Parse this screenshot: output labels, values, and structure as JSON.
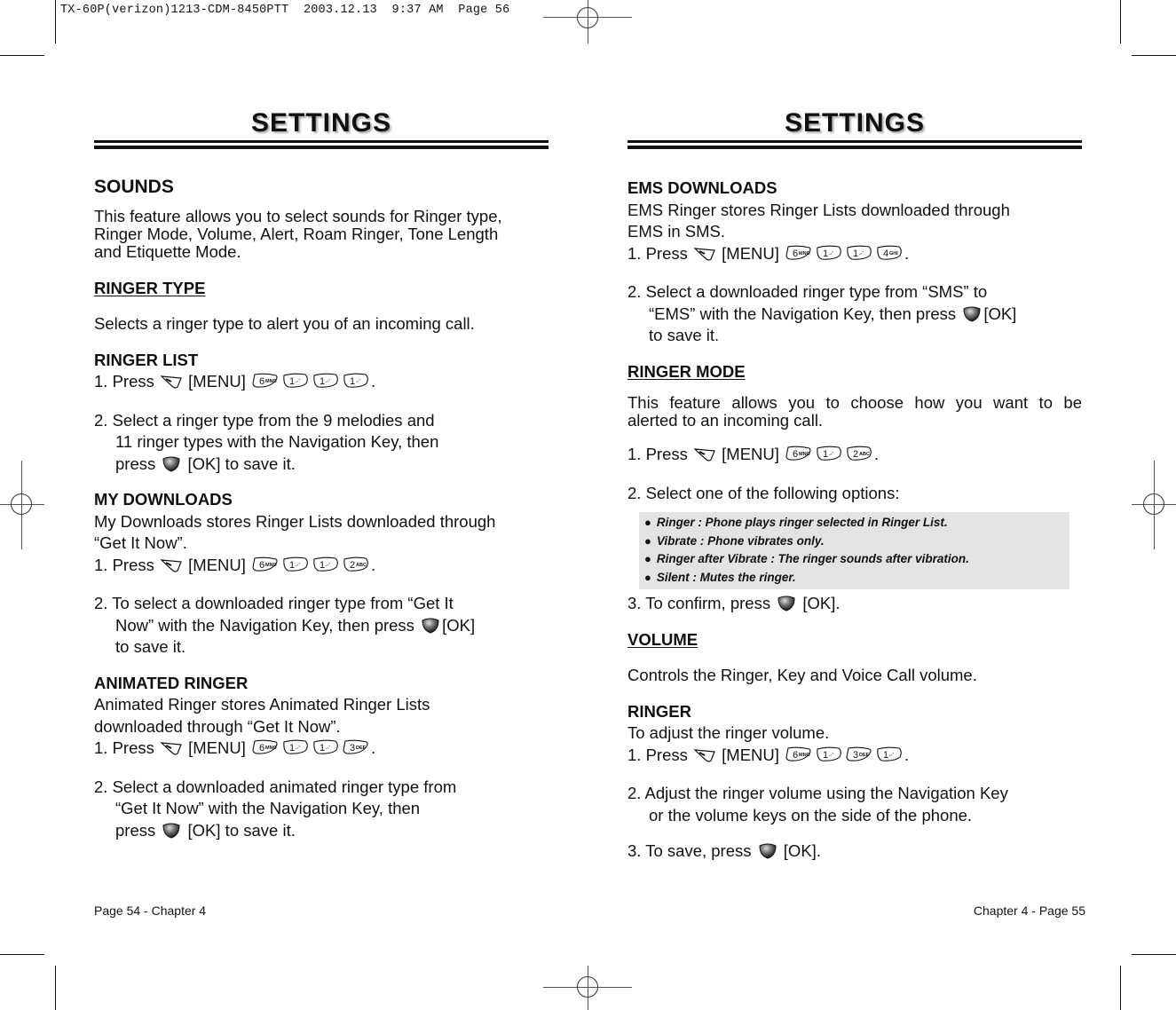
{
  "slug": "TX-60P(verizon)1213-CDM-8450PTT  2003.12.13  9:37 AM  Page 56",
  "left_page": {
    "title": "SETTINGS",
    "sounds": {
      "heading": "SOUNDS",
      "intro_lines": [
        "This feature allows you to select sounds for  Ringer type,",
        "Ringer Mode, Volume, Alert, Roam Ringer, Tone Length",
        "and Etiquette Mode."
      ]
    },
    "ringer_type": {
      "heading": "RINGER TYPE",
      "description": "Selects a ringer type to alert you of an incoming call."
    },
    "ringer_list": {
      "heading": "RINGER LIST",
      "step1_prefix": "1. Press",
      "menu_label": "[MENU]",
      "keys": [
        "6MNO",
        "1",
        "1",
        "1"
      ],
      "step2_lines": [
        "2. Select a ringer type from the 9 melodies and",
        "11 ringer types with the Navigation Key, then"
      ],
      "step2_press": "press",
      "step2_suffix": "[OK] to save it."
    },
    "my_downloads": {
      "heading": "MY DOWNLOADS",
      "desc_lines": [
        "My Downloads stores Ringer Lists downloaded through",
        "“Get It Now”."
      ],
      "step1_prefix": "1. Press",
      "menu_label": "[MENU]",
      "keys": [
        "6MNO",
        "1",
        "1",
        "2ABC"
      ],
      "step2_line1": "2. To select a downloaded ringer type from “Get It",
      "step2_line2_prefix": "Now” with the Navigation Key, then press",
      "step2_line2_suffix": "[OK]",
      "step2_line3": "to save it."
    },
    "animated_ringer": {
      "heading": "ANIMATED RINGER",
      "desc_lines": [
        "Animated Ringer stores Animated Ringer Lists",
        "downloaded through “Get It Now”."
      ],
      "step1_prefix": "1. Press",
      "menu_label": "[MENU]",
      "keys": [
        "6MNO",
        "1",
        "1",
        "3DEF"
      ],
      "step2_lines": [
        "2. Select a downloaded animated ringer type from",
        "“Get It Now” with the Navigation Key, then"
      ],
      "step2_press": "press",
      "step2_suffix": "[OK] to save it."
    },
    "footer": "Page 54 - Chapter 4"
  },
  "right_page": {
    "title": "SETTINGS",
    "ems_downloads": {
      "heading": "EMS DOWNLOADS",
      "desc_lines": [
        "EMS Ringer stores Ringer Lists downloaded through",
        "EMS in SMS."
      ],
      "step1_prefix": "1. Press",
      "menu_label": "[MENU]",
      "keys": [
        "6MNO",
        "1",
        "1",
        "4GHI"
      ],
      "step2_line1": "2. Select a downloaded ringer type from “SMS” to",
      "step2_line2_prefix": "“EMS” with the Navigation Key, then press",
      "step2_line2_suffix": "[OK]",
      "step2_line3": "to save it."
    },
    "ringer_mode": {
      "heading": "RINGER MODE",
      "desc_line1": "This feature allows you to choose how you want to be",
      "desc_line2": "alerted to an incoming call.",
      "step1_prefix": "1. Press",
      "menu_label": "[MENU]",
      "keys": [
        "6MNO",
        "1",
        "2ABC"
      ],
      "step2": "2. Select one of the following options:",
      "options": [
        "Ringer : Phone plays ringer selected in Ringer List.",
        "Vibrate : Phone vibrates only.",
        "Ringer after Vibrate : The ringer sounds after vibration.",
        "Silent : Mutes the ringer."
      ],
      "step3_prefix": "3. To confirm, press",
      "step3_suffix": "[OK]."
    },
    "volume": {
      "heading": "VOLUME",
      "description": "Controls the Ringer, Key and Voice Call volume."
    },
    "ringer": {
      "heading": "RINGER",
      "description": "To adjust the ringer volume.",
      "step1_prefix": "1. Press",
      "menu_label": "[MENU]",
      "keys": [
        "6MNO",
        "1",
        "3DEF",
        "1"
      ],
      "step2_line1": "2. Adjust the ringer volume using the Navigation Key",
      "step2_line2": "or the volume keys on the side of the phone.",
      "step3_prefix": "3. To save, press",
      "step3_suffix": "[OK]."
    },
    "footer": "Chapter 4 - Page 55"
  }
}
